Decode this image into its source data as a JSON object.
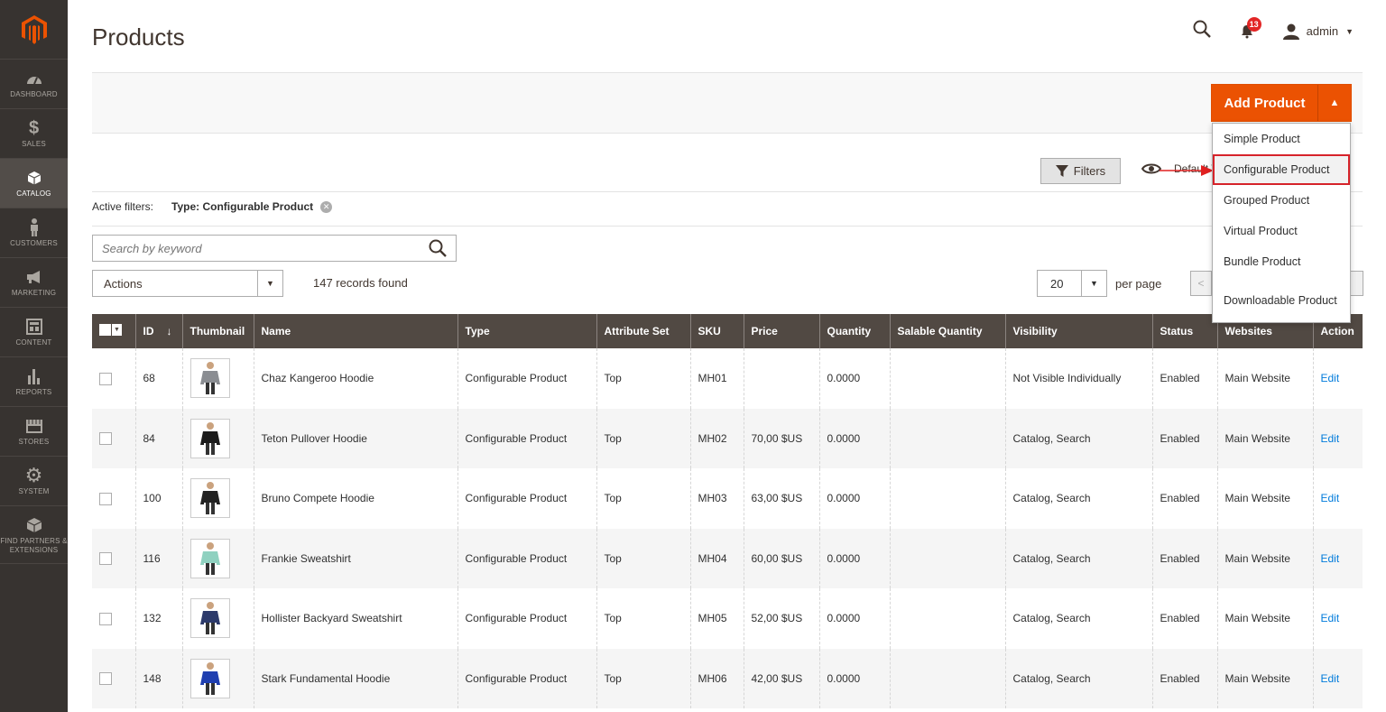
{
  "sidebar": {
    "items": [
      {
        "label": "DASHBOARD",
        "icon": "gauge-icon"
      },
      {
        "label": "SALES",
        "icon": "dollar-icon"
      },
      {
        "label": "CATALOG",
        "icon": "box-icon",
        "active": true
      },
      {
        "label": "CUSTOMERS",
        "icon": "person-icon"
      },
      {
        "label": "MARKETING",
        "icon": "megaphone-icon"
      },
      {
        "label": "CONTENT",
        "icon": "layout-icon"
      },
      {
        "label": "REPORTS",
        "icon": "bar-chart-icon"
      },
      {
        "label": "STORES",
        "icon": "storefront-icon"
      },
      {
        "label": "SYSTEM",
        "icon": "gear-icon"
      },
      {
        "label": "FIND PARTNERS & EXTENSIONS",
        "icon": "cube-icon"
      }
    ]
  },
  "header": {
    "title": "Products",
    "notifications": "13",
    "user": "admin"
  },
  "toolbar": {
    "add_product": "Add Product",
    "add_menu": [
      "Simple Product",
      "Configurable Product",
      "Grouped Product",
      "Virtual Product",
      "Bundle Product",
      "Downloadable Product"
    ],
    "filters": "Filters",
    "view_label": "Default V"
  },
  "active_filters": {
    "label": "Active filters:",
    "value": "Type: Configurable Product"
  },
  "search": {
    "placeholder": "Search by keyword"
  },
  "actions": {
    "label": "Actions"
  },
  "records": "147 records found",
  "pagination": {
    "per_page_value": "20",
    "per_page_label": "per page"
  },
  "grid": {
    "columns": [
      "ID",
      "Thumbnail",
      "Name",
      "Type",
      "Attribute Set",
      "SKU",
      "Price",
      "Quantity",
      "Salable Quantity",
      "Visibility",
      "Status",
      "Websites",
      "Action"
    ],
    "rows": [
      {
        "id": "68",
        "name": "Chaz Kangeroo Hoodie",
        "type": "Configurable Product",
        "attr": "Top",
        "sku": "MH01",
        "price": "",
        "qty": "0.0000",
        "salable": "",
        "visibility": "Not Visible Individually",
        "status": "Enabled",
        "website": "Main Website",
        "action": "Edit",
        "color": "#8a8d92"
      },
      {
        "id": "84",
        "name": "Teton Pullover Hoodie",
        "type": "Configurable Product",
        "attr": "Top",
        "sku": "MH02",
        "price": "70,00 $US",
        "qty": "0.0000",
        "salable": "",
        "visibility": "Catalog, Search",
        "status": "Enabled",
        "website": "Main Website",
        "action": "Edit",
        "color": "#1c1c1c"
      },
      {
        "id": "100",
        "name": "Bruno Compete Hoodie",
        "type": "Configurable Product",
        "attr": "Top",
        "sku": "MH03",
        "price": "63,00 $US",
        "qty": "0.0000",
        "salable": "",
        "visibility": "Catalog, Search",
        "status": "Enabled",
        "website": "Main Website",
        "action": "Edit",
        "color": "#222222"
      },
      {
        "id": "116",
        "name": "Frankie Sweatshirt",
        "type": "Configurable Product",
        "attr": "Top",
        "sku": "MH04",
        "price": "60,00 $US",
        "qty": "0.0000",
        "salable": "",
        "visibility": "Catalog, Search",
        "status": "Enabled",
        "website": "Main Website",
        "action": "Edit",
        "color": "#8fd1c0"
      },
      {
        "id": "132",
        "name": "Hollister Backyard Sweatshirt",
        "type": "Configurable Product",
        "attr": "Top",
        "sku": "MH05",
        "price": "52,00 $US",
        "qty": "0.0000",
        "salable": "",
        "visibility": "Catalog, Search",
        "status": "Enabled",
        "website": "Main Website",
        "action": "Edit",
        "color": "#2c3a6b"
      },
      {
        "id": "148",
        "name": "Stark Fundamental Hoodie",
        "type": "Configurable Product",
        "attr": "Top",
        "sku": "MH06",
        "price": "42,00 $US",
        "qty": "0.0000",
        "salable": "",
        "visibility": "Catalog, Search",
        "status": "Enabled",
        "website": "Main Website",
        "action": "Edit",
        "color": "#1f3fb0"
      }
    ]
  },
  "colors": {
    "accent": "#eb5202",
    "header_bg": "#514943",
    "sidebar_bg": "#373330",
    "link": "#007bdb",
    "highlight": "#d6232a"
  }
}
